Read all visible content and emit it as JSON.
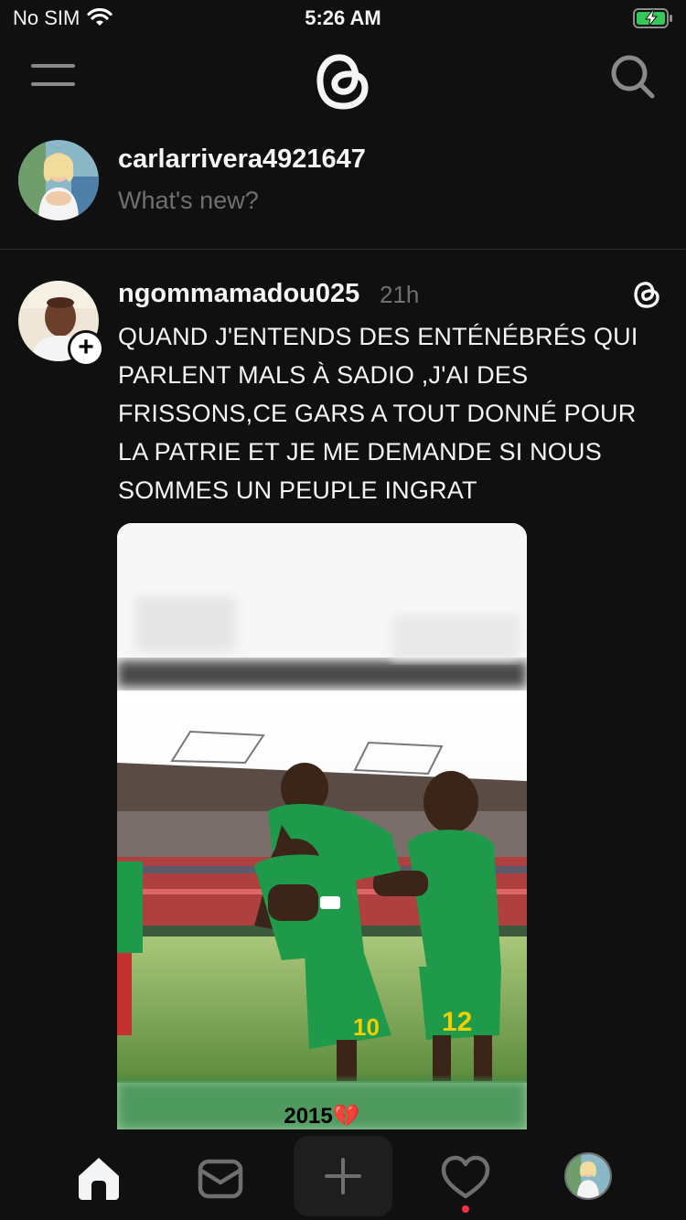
{
  "status_bar": {
    "carrier": "No SIM",
    "time": "5:26 AM"
  },
  "composer": {
    "username": "carlarrivera4921647",
    "placeholder": "What's new?"
  },
  "post": {
    "username": "ngommamadou025",
    "time_ago": "21h",
    "text": "QUAND J'ENTENDS DES ENTÉNÉBRÉS QUI PARLENT MALS À SADIO ,J'AI DES FRISSONS,CE GARS A TOUT DONNÉ POUR LA PATRIE ET JE ME DEMANDE SI NOUS SOMMES UN PEUPLE INGRAT",
    "media_caption": "2015💔",
    "jersey_numbers": [
      "10",
      "12"
    ]
  },
  "icons": {
    "menu": "menu-icon",
    "logo": "threads-logo",
    "search": "search-icon",
    "home": "home-icon",
    "inbox": "inbox-icon",
    "create": "plus-icon",
    "activity": "heart-icon",
    "profile": "avatar"
  },
  "colors": {
    "background": "#101010",
    "text_primary": "#f3f5f7",
    "text_secondary": "#6f6f6f",
    "jersey_green": "#1f9a4a",
    "notification": "#ff3040"
  }
}
